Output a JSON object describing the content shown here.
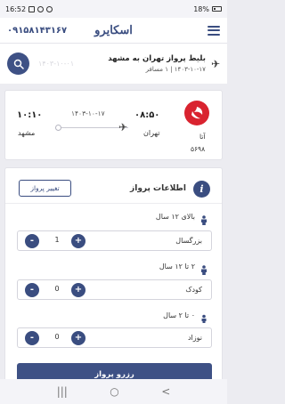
{
  "status_bar": {
    "time": "16:52",
    "battery": "18%"
  },
  "header": {
    "phone": "۰۹۱۵۸۱۴۳۱۶۷",
    "logo_text": "اسکایرو",
    "menu_icon": "hamburger-menu-icon"
  },
  "route_bar": {
    "ghost_text": "۱۴۰۳-۱۰-۰۱",
    "title": "بلیط پرواز تهران به مشهد",
    "subtitle": "۱۴۰۳-۱۰-۱۷ | ۱ مسافر",
    "search_icon": "search-icon",
    "plane_icon": "airplane-icon"
  },
  "flight": {
    "departure_time": "۰۸:۵۰",
    "departure_city": "تهران",
    "arrival_time": "۱۰:۱۰",
    "arrival_city": "مشهد",
    "date": "۱۴۰۳-۱۰-۱۷",
    "airline_name": "آتا",
    "flight_number": "۵۶۹۸",
    "airline_color": "#d9232f"
  },
  "passengers": {
    "title": "اطلاعات پرواز",
    "change_button": "تغییر پرواز",
    "groups": [
      {
        "age_label": "بالای ۱۲ سال",
        "type_label": "بزرگسال",
        "count": "1"
      },
      {
        "age_label": "۲ تا ۱۲ سال",
        "type_label": "کودک",
        "count": "0"
      },
      {
        "age_label": "۰ تا ۲ سال",
        "type_label": "نوزاد",
        "count": "0"
      }
    ],
    "minus_label": "-",
    "plus_label": "+",
    "reserve_button": "رزرو پرواز"
  },
  "nav_bar": {
    "recents": "|||",
    "home": "○",
    "back": "<"
  },
  "colors": {
    "primary": "#3e5185",
    "accent": "#3a4d80",
    "airline_red": "#d9232f"
  }
}
